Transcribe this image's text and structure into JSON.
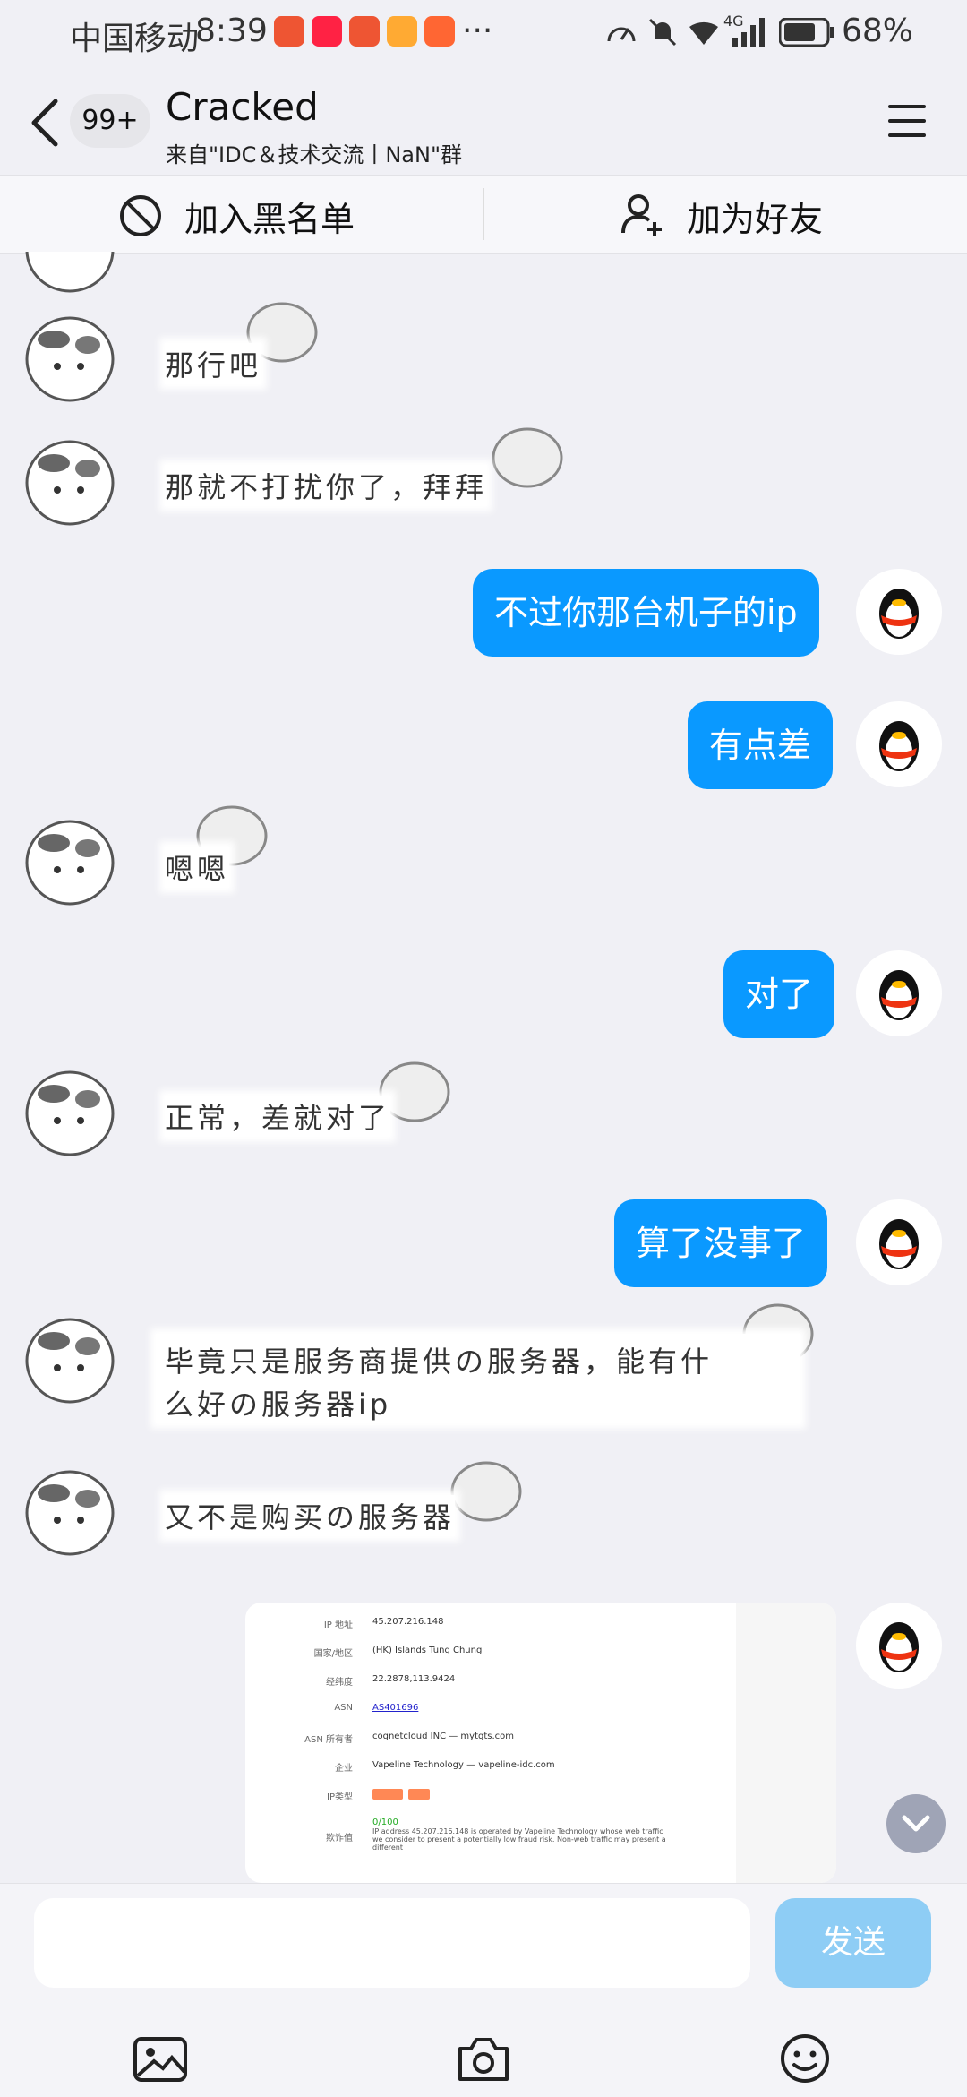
{
  "status_bar": {
    "carrier": "中国移动",
    "time": "8:39",
    "more": "···",
    "network": "4G",
    "battery": "68%"
  },
  "header": {
    "back_count": "99+",
    "title": "Cracked",
    "subtitle": "来自\"IDC＆技术交流丨NaN\"群"
  },
  "actions": {
    "blacklist": "加入黑名单",
    "add_friend": "加为好友"
  },
  "messages": [
    {
      "side": "left",
      "type": "sticker",
      "text": "那行吧"
    },
    {
      "side": "left",
      "type": "sticker",
      "text": "那就不打扰你了，拜拜"
    },
    {
      "side": "right",
      "type": "text",
      "text": "不过你那台机子的ip"
    },
    {
      "side": "right",
      "type": "text",
      "text": "有点差"
    },
    {
      "side": "left",
      "type": "sticker",
      "text": "嗯嗯"
    },
    {
      "side": "right",
      "type": "text",
      "text": "对了"
    },
    {
      "side": "left",
      "type": "sticker",
      "text": "正常，差就对了"
    },
    {
      "side": "right",
      "type": "text",
      "text": "算了没事了"
    },
    {
      "side": "left",
      "type": "sticker",
      "text_line1": "毕竟只是服务商提供の服务器，能有什",
      "text_line2": "么好の服务器ip"
    },
    {
      "side": "left",
      "type": "sticker",
      "text": "又不是购买の服务器"
    }
  ],
  "ip_card": {
    "rows": [
      {
        "label": "IP 地址",
        "value": "45.207.216.148"
      },
      {
        "label": "国家/地区",
        "value": "(HK) Islands Tung Chung"
      },
      {
        "label": "经纬度",
        "value": "22.2878,113.9424"
      },
      {
        "label": "ASN",
        "value": "AS401696"
      },
      {
        "label": "ASN 所有者",
        "value": "cognetcloud INC — mytgts.com"
      },
      {
        "label": "企业",
        "value": "Vapeline Technology — vapeline-idc.com"
      },
      {
        "label": "IP类型",
        "value": ""
      },
      {
        "label": "欺诈值",
        "value": "0/100"
      }
    ],
    "fraud_note": "IP address 45.207.216.148 is operated by Vapeline Technology whose web traffic we consider to present a potentially low fraud risk. Non-web traffic may present a different"
  },
  "composer": {
    "placeholder": "",
    "send_label": "发送"
  },
  "toolbar": {
    "icons": [
      "image-icon",
      "camera-icon",
      "emoji-icon"
    ]
  }
}
